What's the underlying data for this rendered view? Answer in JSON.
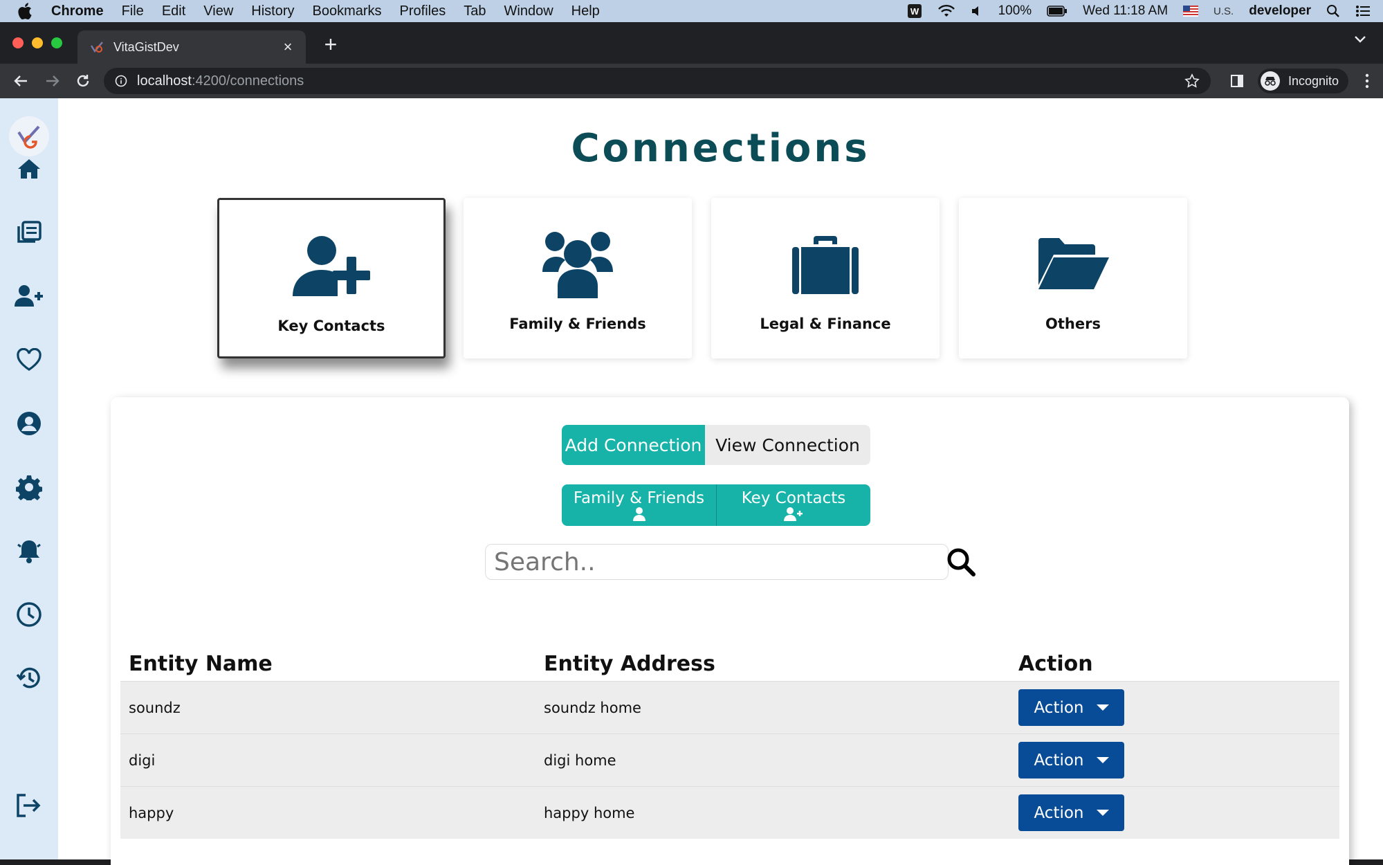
{
  "menubar": {
    "app": "Chrome",
    "items": [
      "File",
      "Edit",
      "View",
      "History",
      "Bookmarks",
      "Profiles",
      "Tab",
      "Window",
      "Help"
    ],
    "battery": "100%",
    "datetime": "Wed 11:18 AM",
    "input_source": "U.S.",
    "user": "developer"
  },
  "browser": {
    "tab_title": "VitaGistDev",
    "url_host": "localhost",
    "url_path": ":4200/connections",
    "profile_label": "Incognito"
  },
  "page": {
    "title": "Connections",
    "categories": [
      {
        "label": "Key Contacts",
        "icon": "user-plus-icon",
        "active": true
      },
      {
        "label": "Family & Friends",
        "icon": "users-icon",
        "active": false
      },
      {
        "label": "Legal & Finance",
        "icon": "briefcase-icon",
        "active": false
      },
      {
        "label": "Others",
        "icon": "folder-open-icon",
        "active": false
      }
    ],
    "mode_toggle": {
      "add": "Add Connection",
      "view": "View Connection",
      "selected": "add"
    },
    "type_toggle": {
      "family": "Family & Friends",
      "key": "Key Contacts"
    },
    "search": {
      "placeholder": "Search..",
      "value": ""
    },
    "table": {
      "headers": [
        "Entity Name",
        "Entity Address",
        "Action"
      ],
      "rows": [
        {
          "name": "soundz",
          "address": "soundz home",
          "action": "Action"
        },
        {
          "name": "digi",
          "address": "digi home",
          "action": "Action"
        },
        {
          "name": "happy",
          "address": "happy home",
          "action": "Action"
        }
      ]
    }
  },
  "colors": {
    "teal": "#17b3a9",
    "navy_icon": "#0d4466",
    "action_blue": "#084c97",
    "title": "#0b4c57",
    "sidebar_bg": "#dce9f7"
  },
  "sidebar_icons": [
    "logo",
    "home-icon",
    "library-icon",
    "user-plus-icon",
    "heart-icon",
    "user-circle-icon",
    "gear-icon",
    "bell-icon",
    "clock-icon",
    "history-icon",
    "logout-icon"
  ]
}
